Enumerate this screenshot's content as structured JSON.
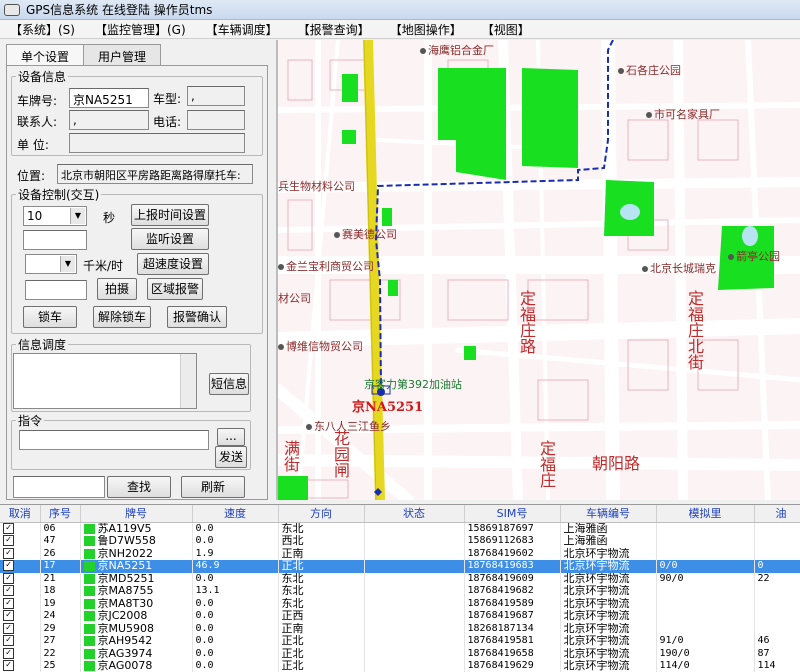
{
  "window": {
    "title": "GPS信息系统  在线登陆  操作员tms"
  },
  "menu": [
    "【系统】(S)",
    "【监控管理】(G)",
    "【车辆调度】",
    "【报警查询】",
    "【地图操作】",
    "【视图】"
  ],
  "tabs": [
    "单个设置",
    "用户管理"
  ],
  "device_info": {
    "legend": "设备信息",
    "plate_label": "车牌号:",
    "plate_value": "京NA5251",
    "type_label": "车型:",
    "type_value": ",",
    "contact_label": "联系人:",
    "contact_value": ",",
    "phone_label": "电话:",
    "phone_value": "",
    "unit_label": "单    位:",
    "unit_value": "",
    "location_label": "位置:",
    "location_value": "北京市朝阳区平房路距离路得摩托车:"
  },
  "device_control": {
    "legend": "设备控制(交互)",
    "interval_value": "10",
    "seconds_label": "秒",
    "upload_button": "上报时间设置",
    "monitor_button": "监听设置",
    "speed_unit": "千米/时",
    "overspeed_button": "超速度设置",
    "photo_button": "拍摄",
    "area_alarm_button": "区域报警",
    "lock_button": "锁车",
    "unlock_button": "解除锁车",
    "alarm_confirm_button": "报警确认"
  },
  "info_dispatch": {
    "legend": "信息调度",
    "sms_button": "短信息"
  },
  "command": {
    "legend": "指令",
    "more_button": "...",
    "send_button": "发送"
  },
  "search": {
    "find_button": "查找",
    "refresh_button": "刷新"
  },
  "map": {
    "pois": [
      "海鹰铝合金厂",
      "石各庄公园",
      "市可名家具厂",
      "兵生物材料公司",
      "赛美德公司",
      "金兰宝利商贸公司",
      "北京长城瑞克",
      "箭亭公园",
      "材公司",
      "博维信物贸公司",
      "京客力第392加油站",
      "东八人三江鱼乡"
    ],
    "roads": [
      "朝阳路",
      "定福庄路",
      "满街",
      "定福庄北街",
      "花园闸",
      "定福庄"
    ],
    "vehicle_label": "京NA5251",
    "colors": {
      "route": "#1a2db0",
      "green": "#18e020",
      "water": "#b6e4f2",
      "road": "#ffffff",
      "main_road": "#e8e020"
    }
  },
  "table": {
    "columns": [
      "取消",
      "序号",
      "牌号",
      "速度",
      "方向",
      "状态",
      "SIM号",
      "车辆编号",
      "模拟里",
      "油"
    ],
    "rows": [
      {
        "no": "06",
        "plate": "苏A119V5",
        "speed": "0.0",
        "dir": "东北",
        "status": "",
        "sim": "15869187697",
        "vid": "上海雅函",
        "mileage": "",
        "oil": ""
      },
      {
        "no": "47",
        "plate": "鲁D7W558",
        "speed": "0.0",
        "dir": "西北",
        "status": "",
        "sim": "15869112683",
        "vid": "上海雅函",
        "mileage": "",
        "oil": ""
      },
      {
        "no": "26",
        "plate": "京NH2022",
        "speed": "1.9",
        "dir": "正南",
        "status": "",
        "sim": "18768419602",
        "vid": "北京环宇物流",
        "mileage": "",
        "oil": ""
      },
      {
        "no": "17",
        "plate": "京NA5251",
        "speed": "46.9",
        "dir": "正北",
        "status": "",
        "sim": "18768419683",
        "vid": "北京环宇物流",
        "mileage": "0/0",
        "oil": "0"
      },
      {
        "no": "21",
        "plate": "京MD5251",
        "speed": "0.0",
        "dir": "东北",
        "status": "",
        "sim": "18768419609",
        "vid": "北京环宇物流",
        "mileage": "90/0",
        "oil": "22"
      },
      {
        "no": "18",
        "plate": "京MA8755",
        "speed": "13.1",
        "dir": "东北",
        "status": "",
        "sim": "18768419682",
        "vid": "北京环宇物流",
        "mileage": "",
        "oil": ""
      },
      {
        "no": "19",
        "plate": "京MA8T30",
        "speed": "0.0",
        "dir": "东北",
        "status": "",
        "sim": "18768419589",
        "vid": "北京环宇物流",
        "mileage": "",
        "oil": ""
      },
      {
        "no": "24",
        "plate": "京JC2008",
        "speed": "0.0",
        "dir": "正西",
        "status": "",
        "sim": "18768419687",
        "vid": "北京环宇物流",
        "mileage": "",
        "oil": ""
      },
      {
        "no": "29",
        "plate": "京MU5908",
        "speed": "0.0",
        "dir": "正南",
        "status": "",
        "sim": "18268187134",
        "vid": "北京环宇物流",
        "mileage": "",
        "oil": ""
      },
      {
        "no": "27",
        "plate": "京AH9542",
        "speed": "0.0",
        "dir": "正北",
        "status": "",
        "sim": "18768419581",
        "vid": "北京环宇物流",
        "mileage": "91/0",
        "oil": "46"
      },
      {
        "no": "22",
        "plate": "京AG3974",
        "speed": "0.0",
        "dir": "正北",
        "status": "",
        "sim": "18768419658",
        "vid": "北京环宇物流",
        "mileage": "190/0",
        "oil": "87"
      },
      {
        "no": "25",
        "plate": "京AG0078",
        "speed": "0.0",
        "dir": "正北",
        "status": "",
        "sim": "18768419629",
        "vid": "北京环宇物流",
        "mileage": "114/0",
        "oil": "114"
      }
    ],
    "selected_index": 3
  }
}
